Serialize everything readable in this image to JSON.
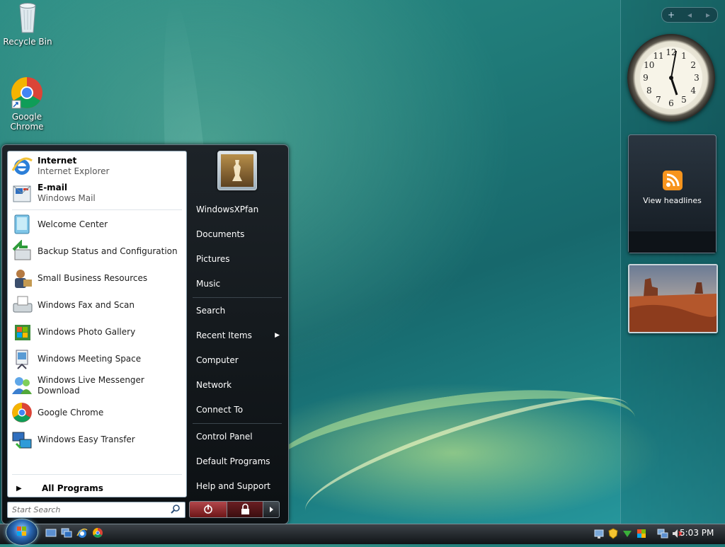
{
  "desktop": {
    "icons": [
      {
        "label": "Recycle Bin",
        "icon": "recycle-bin-icon"
      },
      {
        "label": "Google Chrome",
        "icon": "chrome-icon"
      }
    ]
  },
  "sidebar": {
    "controls": {
      "add": "+",
      "prev": "◂",
      "next": "▸"
    },
    "clock": {
      "icon": "analog-clock",
      "numerals": [
        "12",
        "1",
        "2",
        "3",
        "4",
        "5",
        "6",
        "7",
        "8",
        "9",
        "10",
        "11"
      ],
      "time_shown": "5:03"
    },
    "feed": {
      "label": "View headlines",
      "icon": "rss-icon",
      "accent": "#f7941d"
    },
    "slideshow": {
      "icon": "landscape-photo"
    }
  },
  "start_menu": {
    "pinned": [
      {
        "title": "Internet",
        "subtitle": "Internet Explorer",
        "icon": "internet-explorer-icon"
      },
      {
        "title": "E-mail",
        "subtitle": "Windows Mail",
        "icon": "windows-mail-icon"
      }
    ],
    "recent": [
      {
        "label": "Welcome Center",
        "icon": "welcome-center-icon"
      },
      {
        "label": "Backup Status and Configuration",
        "icon": "backup-icon"
      },
      {
        "label": "Small Business Resources",
        "icon": "business-resources-icon"
      },
      {
        "label": "Windows Fax and Scan",
        "icon": "fax-scan-icon"
      },
      {
        "label": "Windows Photo Gallery",
        "icon": "photo-gallery-icon"
      },
      {
        "label": "Windows Meeting Space",
        "icon": "meeting-space-icon"
      },
      {
        "label": "Windows Live Messenger Download",
        "icon": "messenger-icon"
      },
      {
        "label": "Google Chrome",
        "icon": "chrome-icon"
      },
      {
        "label": "Windows Easy Transfer",
        "icon": "easy-transfer-icon"
      }
    ],
    "all_programs": "All Programs",
    "search_placeholder": "Start Search",
    "right": {
      "user": "WindowsXPfan",
      "items_group1": [
        "Documents",
        "Pictures",
        "Music"
      ],
      "items_group2": [
        "Search",
        "Recent Items",
        "Computer",
        "Network",
        "Connect To"
      ],
      "items_group3": [
        "Control Panel",
        "Default Programs",
        "Help and Support"
      ]
    },
    "power": {
      "power_icon": "power-icon",
      "lock_icon": "lock-icon",
      "arrow_icon": "arrow-right-icon"
    }
  },
  "taskbar": {
    "quick_launch": [
      "show-desktop-icon",
      "switch-windows-icon",
      "internet-explorer-icon",
      "chrome-icon"
    ],
    "tray_icons": [
      "network-icon",
      "security-shield-icon",
      "safely-remove-icon",
      "windows-update-icon",
      "network-connection-icon",
      "volume-muted-icon"
    ],
    "time": "5:03 PM"
  }
}
